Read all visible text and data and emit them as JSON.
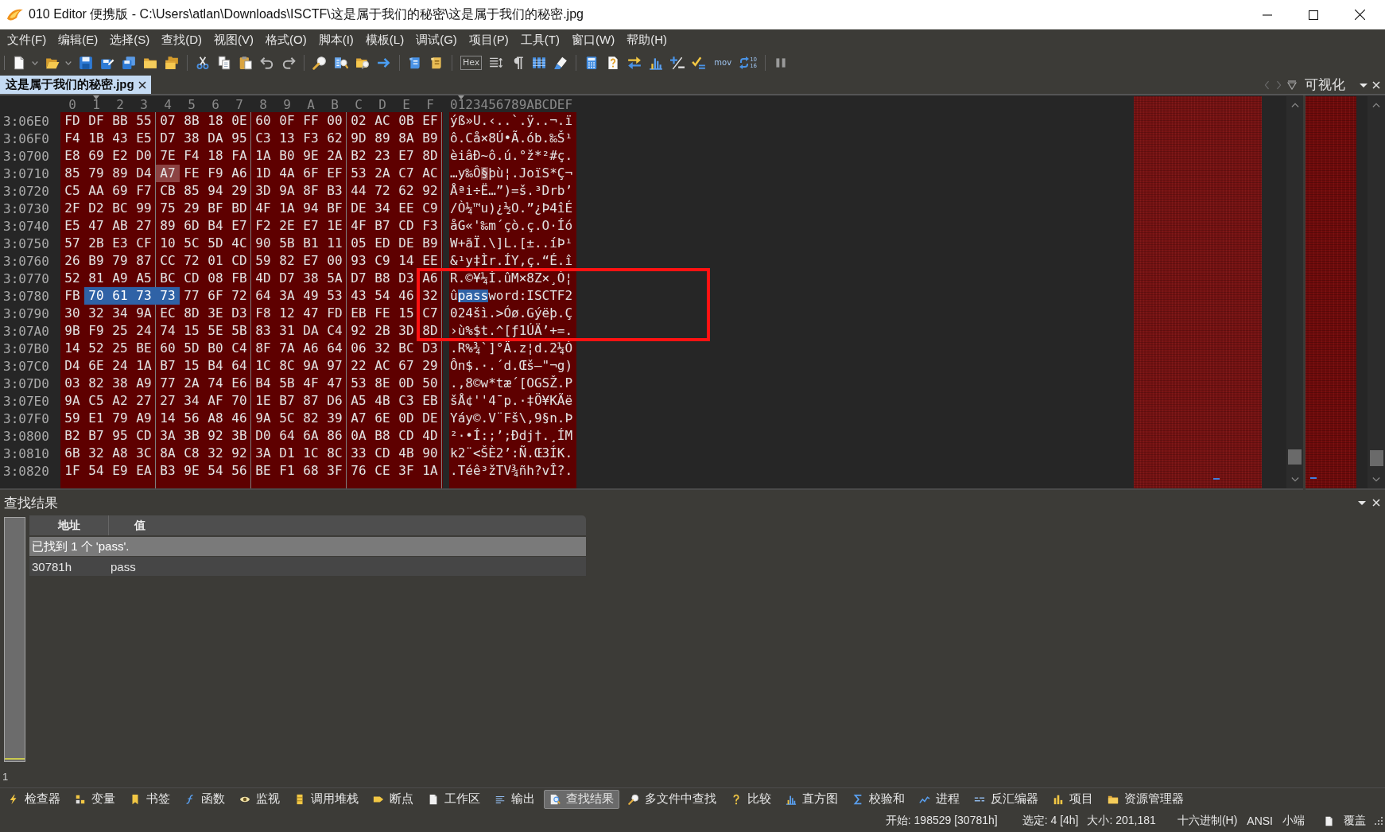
{
  "window": {
    "title": "010 Editor 便携版 - C:\\Users\\atlan\\Downloads\\ISCTF\\这是属于我们的秘密\\这是属于我们的秘密.jpg"
  },
  "menu": [
    "文件(F)",
    "编辑(E)",
    "选择(S)",
    "查找(D)",
    "视图(V)",
    "格式(O)",
    "脚本(I)",
    "模板(L)",
    "调试(G)",
    "项目(P)",
    "工具(T)",
    "窗口(W)",
    "帮助(H)"
  ],
  "toolbar": {
    "hex_label": "Hex",
    "mov_label": "mov",
    "base_labels": [
      "10",
      "16"
    ]
  },
  "file_tabs": [
    {
      "label": "这是属于我们的秘密.jpg",
      "selected": true
    }
  ],
  "visualization_panel": {
    "title": "可视化"
  },
  "hex_view": {
    "column_headers": [
      "0",
      "1",
      "2",
      "3",
      "4",
      "5",
      "6",
      "7",
      "8",
      "9",
      "A",
      "B",
      "C",
      "D",
      "E",
      "F"
    ],
    "text_header": "0123456789ABCDEF",
    "rows": [
      {
        "address": "3:06E0",
        "segments": [
          {
            "bytes": [
              "FD",
              "DF",
              "BB",
              "55",
              "07",
              "8B",
              "18",
              "0E",
              "60",
              "0F",
              "FF",
              "00",
              "02",
              "AC",
              "0B",
              "EF"
            ],
            "text": "ýß»U.‹..`.ÿ..¬.ï",
            "selected": false,
            "cursor": false
          }
        ]
      },
      {
        "address": "3:06F0",
        "segments": [
          {
            "bytes": [
              "F4",
              "1B",
              "43",
              "E5",
              "D7",
              "38",
              "DA",
              "95",
              "C3",
              "13",
              "F3",
              "62",
              "9D",
              "89",
              "8A",
              "B9"
            ],
            "text": "ô.Cå×8Ú•Ã.ób.‰Š¹",
            "selected": false,
            "cursor": false
          }
        ]
      },
      {
        "address": "3:0700",
        "segments": [
          {
            "bytes": [
              "E8",
              "69",
              "E2",
              "D0",
              "7E",
              "F4",
              "18",
              "FA",
              "1A",
              "B0",
              "9E",
              "2A",
              "B2",
              "23",
              "E7",
              "8D"
            ],
            "text": "èiâÐ~ô.ú.°ž*²#ç.",
            "selected": false,
            "cursor": false
          }
        ]
      },
      {
        "address": "3:0710",
        "segments": [
          {
            "bytes": [
              "85",
              "79",
              "89",
              "D4"
            ],
            "text": "…y‰Ô",
            "selected": false,
            "cursor": false
          },
          {
            "bytes": [
              "A7"
            ],
            "text": "§",
            "selected": false,
            "cursor": true
          },
          {
            "bytes": [
              "FE",
              "F9",
              "A6",
              "1D",
              "4A",
              "6F",
              "EF",
              "53",
              "2A",
              "C7",
              "AC"
            ],
            "text": "þù¦.JoïS*Ç¬",
            "selected": false,
            "cursor": false
          }
        ]
      },
      {
        "address": "3:0720",
        "segments": [
          {
            "bytes": [
              "C5",
              "AA",
              "69",
              "F7",
              "CB",
              "85",
              "94",
              "29",
              "3D",
              "9A",
              "8F",
              "B3",
              "44",
              "72",
              "62",
              "92"
            ],
            "text": "Åªi÷Ë…”)=š.³Drb’",
            "selected": false,
            "cursor": false
          }
        ]
      },
      {
        "address": "3:0730",
        "segments": [
          {
            "bytes": [
              "2F",
              "D2",
              "BC",
              "99",
              "75",
              "29",
              "BF",
              "BD",
              "4F",
              "1A",
              "94",
              "BF",
              "DE",
              "34",
              "EE",
              "C9"
            ],
            "text": "/Ò¼™u)¿½O.”¿Þ4îÉ",
            "selected": false,
            "cursor": false
          }
        ]
      },
      {
        "address": "3:0740",
        "segments": [
          {
            "bytes": [
              "E5",
              "47",
              "AB",
              "27",
              "89",
              "6D",
              "B4",
              "E7",
              "F2",
              "2E",
              "E7",
              "1E",
              "4F",
              "B7",
              "CD",
              "F3"
            ],
            "text": "åG«'‰m´çò.ç.O·Íó",
            "selected": false,
            "cursor": false
          }
        ]
      },
      {
        "address": "3:0750",
        "segments": [
          {
            "bytes": [
              "57",
              "2B",
              "E3",
              "CF",
              "10",
              "5C",
              "5D",
              "4C",
              "90",
              "5B",
              "B1",
              "11",
              "05",
              "ED",
              "DE",
              "B9"
            ],
            "text": "W+ãÏ.\\]L.[±..íÞ¹",
            "selected": false,
            "cursor": false
          }
        ]
      },
      {
        "address": "3:0760",
        "segments": [
          {
            "bytes": [
              "26",
              "B9",
              "79",
              "87",
              "CC",
              "72",
              "01",
              "CD",
              "59",
              "82",
              "E7",
              "00",
              "93",
              "C9",
              "14",
              "EE"
            ],
            "text": "&¹y‡Ìr.ÍY‚ç.“É.î",
            "selected": false,
            "cursor": false
          }
        ]
      },
      {
        "address": "3:0770",
        "segments": [
          {
            "bytes": [
              "52",
              "81",
              "A9",
              "A5",
              "BC",
              "CD",
              "08",
              "FB",
              "4D",
              "D7",
              "38",
              "5A",
              "D7",
              "B8",
              "D3",
              "A6"
            ],
            "text": "R.©¥¼Í.ûM×8Z×¸Ó¦",
            "selected": false,
            "cursor": false
          }
        ]
      },
      {
        "address": "3:0780",
        "segments": [
          {
            "bytes": [
              "FB"
            ],
            "text": "û",
            "selected": false,
            "cursor": false
          },
          {
            "bytes": [
              "70",
              "61",
              "73",
              "73"
            ],
            "text": "pass",
            "selected": true,
            "cursor": false
          },
          {
            "bytes": [
              "77",
              "6F",
              "72",
              "64",
              "3A",
              "49",
              "53",
              "43",
              "54",
              "46",
              "32"
            ],
            "text": "word:ISCTF2",
            "selected": false,
            "cursor": false
          }
        ]
      },
      {
        "address": "3:0790",
        "segments": [
          {
            "bytes": [
              "30",
              "32",
              "34",
              "9A",
              "EC",
              "8D",
              "3E",
              "D3",
              "F8",
              "12",
              "47",
              "FD",
              "EB",
              "FE",
              "15",
              "C7"
            ],
            "text": "024šì.>Óø.Gýëþ.Ç",
            "selected": false,
            "cursor": false
          }
        ]
      },
      {
        "address": "3:07A0",
        "segments": [
          {
            "bytes": [
              "9B",
              "F9",
              "25",
              "24",
              "74",
              "15",
              "5E",
              "5B",
              "83",
              "31",
              "DA",
              "C4",
              "92",
              "2B",
              "3D",
              "8D"
            ],
            "text": "›ù%$t.^[ƒ1ÚÄ’+=.",
            "selected": false,
            "cursor": false
          }
        ]
      },
      {
        "address": "3:07B0",
        "segments": [
          {
            "bytes": [
              "14",
              "52",
              "25",
              "BE",
              "60",
              "5D",
              "B0",
              "C4",
              "8F",
              "7A",
              "A6",
              "64",
              "06",
              "32",
              "BC",
              "D3"
            ],
            "text": ".R%¾`]°Ä.z¦d.2¼Ó",
            "selected": false,
            "cursor": false
          }
        ]
      },
      {
        "address": "3:07C0",
        "segments": [
          {
            "bytes": [
              "D4",
              "6E",
              "24",
              "1A",
              "B7",
              "15",
              "B4",
              "64",
              "1C",
              "8C",
              "9A",
              "97",
              "22",
              "AC",
              "67",
              "29"
            ],
            "text": "Ôn$.·.´d.Œš—\"¬g)",
            "selected": false,
            "cursor": false
          }
        ]
      },
      {
        "address": "3:07D0",
        "segments": [
          {
            "bytes": [
              "03",
              "82",
              "38",
              "A9",
              "77",
              "2A",
              "74",
              "E6",
              "B4",
              "5B",
              "4F",
              "47",
              "53",
              "8E",
              "0D",
              "50"
            ],
            "text": ".‚8©w*tæ´[OGSŽ.P",
            "selected": false,
            "cursor": false
          }
        ]
      },
      {
        "address": "3:07E0",
        "segments": [
          {
            "bytes": [
              "9A",
              "C5",
              "A2",
              "27",
              "27",
              "34",
              "AF",
              "70",
              "1E",
              "B7",
              "87",
              "D6",
              "A5",
              "4B",
              "C3",
              "EB"
            ],
            "text": "šÅ¢''4¯p.·‡Ö¥KÃë",
            "selected": false,
            "cursor": false
          }
        ]
      },
      {
        "address": "3:07F0",
        "segments": [
          {
            "bytes": [
              "59",
              "E1",
              "79",
              "A9",
              "14",
              "56",
              "A8",
              "46",
              "9A",
              "5C",
              "82",
              "39",
              "A7",
              "6E",
              "0D",
              "DE"
            ],
            "text": "Yáy©.V¨Fš\\‚9§n.Þ",
            "selected": false,
            "cursor": false
          }
        ]
      },
      {
        "address": "3:0800",
        "segments": [
          {
            "bytes": [
              "B2",
              "B7",
              "95",
              "CD",
              "3A",
              "3B",
              "92",
              "3B",
              "D0",
              "64",
              "6A",
              "86",
              "0A",
              "B8",
              "CD",
              "4D"
            ],
            "text": "²·•Í:;’;Ðdj†.¸ÍM",
            "selected": false,
            "cursor": false
          }
        ]
      },
      {
        "address": "3:0810",
        "segments": [
          {
            "bytes": [
              "6B",
              "32",
              "A8",
              "3C",
              "8A",
              "C8",
              "32",
              "92",
              "3A",
              "D1",
              "1C",
              "8C",
              "33",
              "CD",
              "4B",
              "90"
            ],
            "text": "k2¨<ŠÈ2’:Ñ.Œ3ÍK.",
            "selected": false,
            "cursor": false
          }
        ]
      },
      {
        "address": "3:0820",
        "segments": [
          {
            "bytes": [
              "1F",
              "54",
              "E9",
              "EA",
              "B3",
              "9E",
              "54",
              "56",
              "BE",
              "F1",
              "68",
              "3F",
              "76",
              "CE",
              "3F",
              "1A"
            ],
            "text": ".Téê³žTV¾ñh?vÎ?.",
            "selected": false,
            "cursor": false
          }
        ]
      }
    ]
  },
  "annotations": [
    {
      "kind": "box"
    }
  ],
  "find_results": {
    "title": "查找结果",
    "columns": [
      "地址",
      "值"
    ],
    "rows": [
      {
        "kind": "summary",
        "text": "已找到 1 个 'pass'.",
        "selected": true
      },
      {
        "kind": "result",
        "address": "30781h",
        "value": "pass",
        "selected": false
      }
    ],
    "counter": "1"
  },
  "bottom_tabs": [
    {
      "label": "检查器",
      "selected": false
    },
    {
      "label": "变量",
      "selected": false
    },
    {
      "label": "书签",
      "selected": false
    },
    {
      "label": "函数",
      "selected": false
    },
    {
      "label": "监视",
      "selected": false
    },
    {
      "label": "调用堆栈",
      "selected": false
    },
    {
      "label": "断点",
      "selected": false
    },
    {
      "label": "工作区",
      "selected": false
    },
    {
      "label": "输出",
      "selected": false
    },
    {
      "label": "查找结果",
      "selected": true
    },
    {
      "label": "多文件中查找",
      "selected": false
    },
    {
      "label": "比较",
      "selected": false
    },
    {
      "label": "直方图",
      "selected": false
    },
    {
      "label": "校验和",
      "selected": false
    },
    {
      "label": "进程",
      "selected": false
    },
    {
      "label": "反汇编器",
      "selected": false
    },
    {
      "label": "项目",
      "selected": false
    },
    {
      "label": "资源管理器",
      "selected": false
    }
  ],
  "status_bar": {
    "start": "开始: 198529 [30781h]",
    "selection": "选定: 4 [4h]",
    "size": "大小: 201,181",
    "mode": "十六进制(H)",
    "encoding": "ANSI",
    "endian": "小端",
    "insert_mode": "覆盖"
  }
}
